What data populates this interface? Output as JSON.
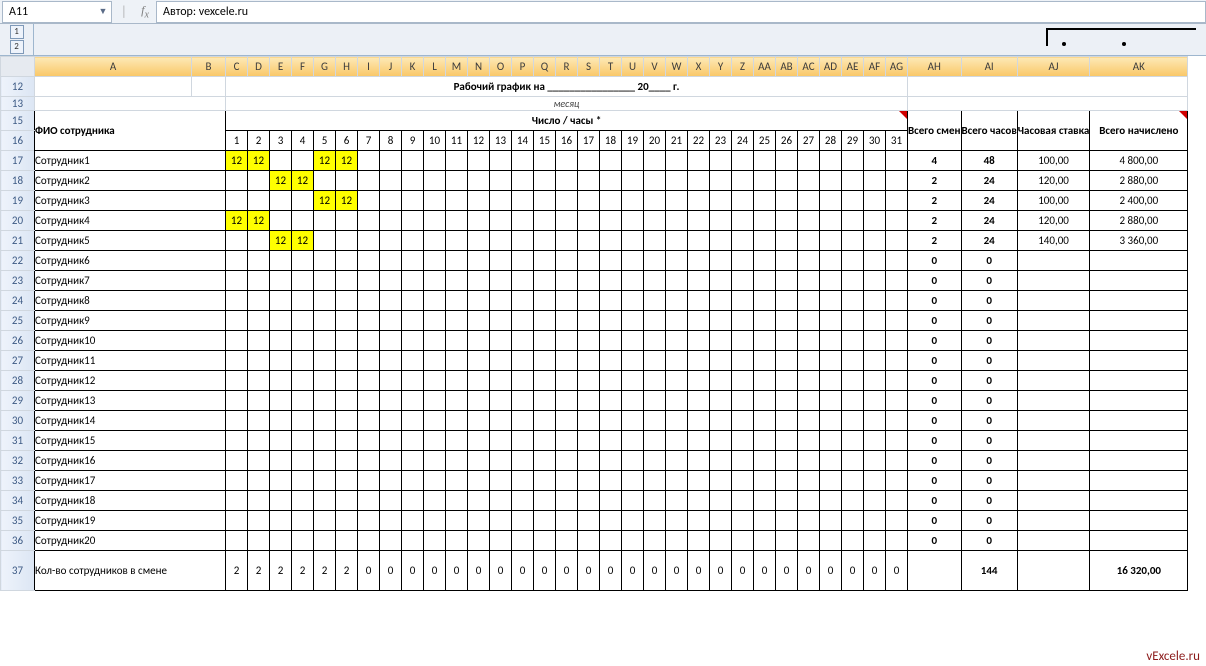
{
  "name_box": "A11",
  "formula": "Автор: vexcele.ru",
  "outline_levels": [
    "1",
    "2"
  ],
  "col_headers": [
    "A",
    "B",
    "C",
    "D",
    "E",
    "F",
    "G",
    "H",
    "I",
    "J",
    "K",
    "L",
    "M",
    "N",
    "O",
    "P",
    "Q",
    "R",
    "S",
    "T",
    "U",
    "V",
    "W",
    "X",
    "Y",
    "Z",
    "AA",
    "AB",
    "AC",
    "AD",
    "AE",
    "AF",
    "AG",
    "AH",
    "AI",
    "AJ",
    "AK"
  ],
  "row_headers": [
    "12",
    "13",
    "15",
    "16",
    "17",
    "18",
    "19",
    "20",
    "21",
    "22",
    "23",
    "24",
    "25",
    "26",
    "27",
    "28",
    "29",
    "30",
    "31",
    "32",
    "33",
    "34",
    "35",
    "36",
    "37"
  ],
  "title_line": "Рабочий график на ________________ 20____ г.",
  "title_sub": "месяц",
  "hdr_name": "ФИО сотрудника",
  "hdr_days": "Число / часы *",
  "day_nums": [
    "1",
    "2",
    "3",
    "4",
    "5",
    "6",
    "7",
    "8",
    "9",
    "10",
    "11",
    "12",
    "13",
    "14",
    "15",
    "16",
    "17",
    "18",
    "19",
    "20",
    "21",
    "22",
    "23",
    "24",
    "25",
    "26",
    "27",
    "28",
    "29",
    "30",
    "31"
  ],
  "hdr_shifts": "Всего смен",
  "hdr_hours": "Всего часов",
  "hdr_rate": "Часовая ставка",
  "hdr_total": "Всего начислено",
  "employees": [
    {
      "name": "Сотрудник1",
      "d": [
        "12",
        "12",
        "",
        "",
        "12",
        "12",
        "",
        "",
        "",
        "",
        "",
        "",
        "",
        "",
        "",
        "",
        "",
        "",
        "",
        "",
        "",
        "",
        "",
        "",
        "",
        "",
        "",
        "",
        "",
        "",
        ""
      ],
      "shifts": "4",
      "hours": "48",
      "rate": "100,00",
      "total": "4 800,00",
      "yellow": [
        0,
        1,
        4,
        5
      ]
    },
    {
      "name": "Сотрудник2",
      "d": [
        "",
        "",
        "12",
        "12",
        "",
        "",
        "",
        "",
        "",
        "",
        "",
        "",
        "",
        "",
        "",
        "",
        "",
        "",
        "",
        "",
        "",
        "",
        "",
        "",
        "",
        "",
        "",
        "",
        "",
        "",
        ""
      ],
      "shifts": "2",
      "hours": "24",
      "rate": "120,00",
      "total": "2 880,00",
      "yellow": [
        2,
        3
      ]
    },
    {
      "name": "Сотрудник3",
      "d": [
        "",
        "",
        "",
        "",
        "12",
        "12",
        "",
        "",
        "",
        "",
        "",
        "",
        "",
        "",
        "",
        "",
        "",
        "",
        "",
        "",
        "",
        "",
        "",
        "",
        "",
        "",
        "",
        "",
        "",
        "",
        ""
      ],
      "shifts": "2",
      "hours": "24",
      "rate": "100,00",
      "total": "2 400,00",
      "yellow": [
        4,
        5
      ]
    },
    {
      "name": "Сотрудник4",
      "d": [
        "12",
        "12",
        "",
        "",
        "",
        "",
        "",
        "",
        "",
        "",
        "",
        "",
        "",
        "",
        "",
        "",
        "",
        "",
        "",
        "",
        "",
        "",
        "",
        "",
        "",
        "",
        "",
        "",
        "",
        "",
        ""
      ],
      "shifts": "2",
      "hours": "24",
      "rate": "120,00",
      "total": "2 880,00",
      "yellow": [
        0,
        1
      ]
    },
    {
      "name": "Сотрудник5",
      "d": [
        "",
        "",
        "12",
        "12",
        "",
        "",
        "",
        "",
        "",
        "",
        "",
        "",
        "",
        "",
        "",
        "",
        "",
        "",
        "",
        "",
        "",
        "",
        "",
        "",
        "",
        "",
        "",
        "",
        "",
        "",
        ""
      ],
      "shifts": "2",
      "hours": "24",
      "rate": "140,00",
      "total": "3 360,00",
      "yellow": [
        2,
        3
      ]
    },
    {
      "name": "Сотрудник6",
      "d": [
        "",
        "",
        "",
        "",
        "",
        "",
        "",
        "",
        "",
        "",
        "",
        "",
        "",
        "",
        "",
        "",
        "",
        "",
        "",
        "",
        "",
        "",
        "",
        "",
        "",
        "",
        "",
        "",
        "",
        "",
        ""
      ],
      "shifts": "0",
      "hours": "0",
      "rate": "",
      "total": "",
      "yellow": []
    },
    {
      "name": "Сотрудник7",
      "d": [
        "",
        "",
        "",
        "",
        "",
        "",
        "",
        "",
        "",
        "",
        "",
        "",
        "",
        "",
        "",
        "",
        "",
        "",
        "",
        "",
        "",
        "",
        "",
        "",
        "",
        "",
        "",
        "",
        "",
        "",
        ""
      ],
      "shifts": "0",
      "hours": "0",
      "rate": "",
      "total": "",
      "yellow": []
    },
    {
      "name": "Сотрудник8",
      "d": [
        "",
        "",
        "",
        "",
        "",
        "",
        "",
        "",
        "",
        "",
        "",
        "",
        "",
        "",
        "",
        "",
        "",
        "",
        "",
        "",
        "",
        "",
        "",
        "",
        "",
        "",
        "",
        "",
        "",
        "",
        ""
      ],
      "shifts": "0",
      "hours": "0",
      "rate": "",
      "total": "",
      "yellow": []
    },
    {
      "name": "Сотрудник9",
      "d": [
        "",
        "",
        "",
        "",
        "",
        "",
        "",
        "",
        "",
        "",
        "",
        "",
        "",
        "",
        "",
        "",
        "",
        "",
        "",
        "",
        "",
        "",
        "",
        "",
        "",
        "",
        "",
        "",
        "",
        "",
        ""
      ],
      "shifts": "0",
      "hours": "0",
      "rate": "",
      "total": "",
      "yellow": []
    },
    {
      "name": "Сотрудник10",
      "d": [
        "",
        "",
        "",
        "",
        "",
        "",
        "",
        "",
        "",
        "",
        "",
        "",
        "",
        "",
        "",
        "",
        "",
        "",
        "",
        "",
        "",
        "",
        "",
        "",
        "",
        "",
        "",
        "",
        "",
        "",
        ""
      ],
      "shifts": "0",
      "hours": "0",
      "rate": "",
      "total": "",
      "yellow": []
    },
    {
      "name": "Сотрудник11",
      "d": [
        "",
        "",
        "",
        "",
        "",
        "",
        "",
        "",
        "",
        "",
        "",
        "",
        "",
        "",
        "",
        "",
        "",
        "",
        "",
        "",
        "",
        "",
        "",
        "",
        "",
        "",
        "",
        "",
        "",
        "",
        ""
      ],
      "shifts": "0",
      "hours": "0",
      "rate": "",
      "total": "",
      "yellow": []
    },
    {
      "name": "Сотрудник12",
      "d": [
        "",
        "",
        "",
        "",
        "",
        "",
        "",
        "",
        "",
        "",
        "",
        "",
        "",
        "",
        "",
        "",
        "",
        "",
        "",
        "",
        "",
        "",
        "",
        "",
        "",
        "",
        "",
        "",
        "",
        "",
        ""
      ],
      "shifts": "0",
      "hours": "0",
      "rate": "",
      "total": "",
      "yellow": []
    },
    {
      "name": "Сотрудник13",
      "d": [
        "",
        "",
        "",
        "",
        "",
        "",
        "",
        "",
        "",
        "",
        "",
        "",
        "",
        "",
        "",
        "",
        "",
        "",
        "",
        "",
        "",
        "",
        "",
        "",
        "",
        "",
        "",
        "",
        "",
        "",
        ""
      ],
      "shifts": "0",
      "hours": "0",
      "rate": "",
      "total": "",
      "yellow": []
    },
    {
      "name": "Сотрудник14",
      "d": [
        "",
        "",
        "",
        "",
        "",
        "",
        "",
        "",
        "",
        "",
        "",
        "",
        "",
        "",
        "",
        "",
        "",
        "",
        "",
        "",
        "",
        "",
        "",
        "",
        "",
        "",
        "",
        "",
        "",
        "",
        ""
      ],
      "shifts": "0",
      "hours": "0",
      "rate": "",
      "total": "",
      "yellow": []
    },
    {
      "name": "Сотрудник15",
      "d": [
        "",
        "",
        "",
        "",
        "",
        "",
        "",
        "",
        "",
        "",
        "",
        "",
        "",
        "",
        "",
        "",
        "",
        "",
        "",
        "",
        "",
        "",
        "",
        "",
        "",
        "",
        "",
        "",
        "",
        "",
        ""
      ],
      "shifts": "0",
      "hours": "0",
      "rate": "",
      "total": "",
      "yellow": []
    },
    {
      "name": "Сотрудник16",
      "d": [
        "",
        "",
        "",
        "",
        "",
        "",
        "",
        "",
        "",
        "",
        "",
        "",
        "",
        "",
        "",
        "",
        "",
        "",
        "",
        "",
        "",
        "",
        "",
        "",
        "",
        "",
        "",
        "",
        "",
        "",
        ""
      ],
      "shifts": "0",
      "hours": "0",
      "rate": "",
      "total": "",
      "yellow": []
    },
    {
      "name": "Сотрудник17",
      "d": [
        "",
        "",
        "",
        "",
        "",
        "",
        "",
        "",
        "",
        "",
        "",
        "",
        "",
        "",
        "",
        "",
        "",
        "",
        "",
        "",
        "",
        "",
        "",
        "",
        "",
        "",
        "",
        "",
        "",
        "",
        ""
      ],
      "shifts": "0",
      "hours": "0",
      "rate": "",
      "total": "",
      "yellow": []
    },
    {
      "name": "Сотрудник18",
      "d": [
        "",
        "",
        "",
        "",
        "",
        "",
        "",
        "",
        "",
        "",
        "",
        "",
        "",
        "",
        "",
        "",
        "",
        "",
        "",
        "",
        "",
        "",
        "",
        "",
        "",
        "",
        "",
        "",
        "",
        "",
        ""
      ],
      "shifts": "0",
      "hours": "0",
      "rate": "",
      "total": "",
      "yellow": []
    },
    {
      "name": "Сотрудник19",
      "d": [
        "",
        "",
        "",
        "",
        "",
        "",
        "",
        "",
        "",
        "",
        "",
        "",
        "",
        "",
        "",
        "",
        "",
        "",
        "",
        "",
        "",
        "",
        "",
        "",
        "",
        "",
        "",
        "",
        "",
        "",
        ""
      ],
      "shifts": "0",
      "hours": "0",
      "rate": "",
      "total": "",
      "yellow": []
    },
    {
      "name": "Сотрудник20",
      "d": [
        "",
        "",
        "",
        "",
        "",
        "",
        "",
        "",
        "",
        "",
        "",
        "",
        "",
        "",
        "",
        "",
        "",
        "",
        "",
        "",
        "",
        "",
        "",
        "",
        "",
        "",
        "",
        "",
        "",
        "",
        ""
      ],
      "shifts": "0",
      "hours": "0",
      "rate": "",
      "total": "",
      "yellow": []
    }
  ],
  "footer_label": "Кол-во сотрудников в смене",
  "footer_counts": [
    "2",
    "2",
    "2",
    "2",
    "2",
    "2",
    "0",
    "0",
    "0",
    "0",
    "0",
    "0",
    "0",
    "0",
    "0",
    "0",
    "0",
    "0",
    "0",
    "0",
    "0",
    "0",
    "0",
    "0",
    "0",
    "0",
    "0",
    "0",
    "0",
    "0",
    "0"
  ],
  "footer_hours": "144",
  "footer_total": "16 320,00",
  "watermark": "vExcele.ru"
}
